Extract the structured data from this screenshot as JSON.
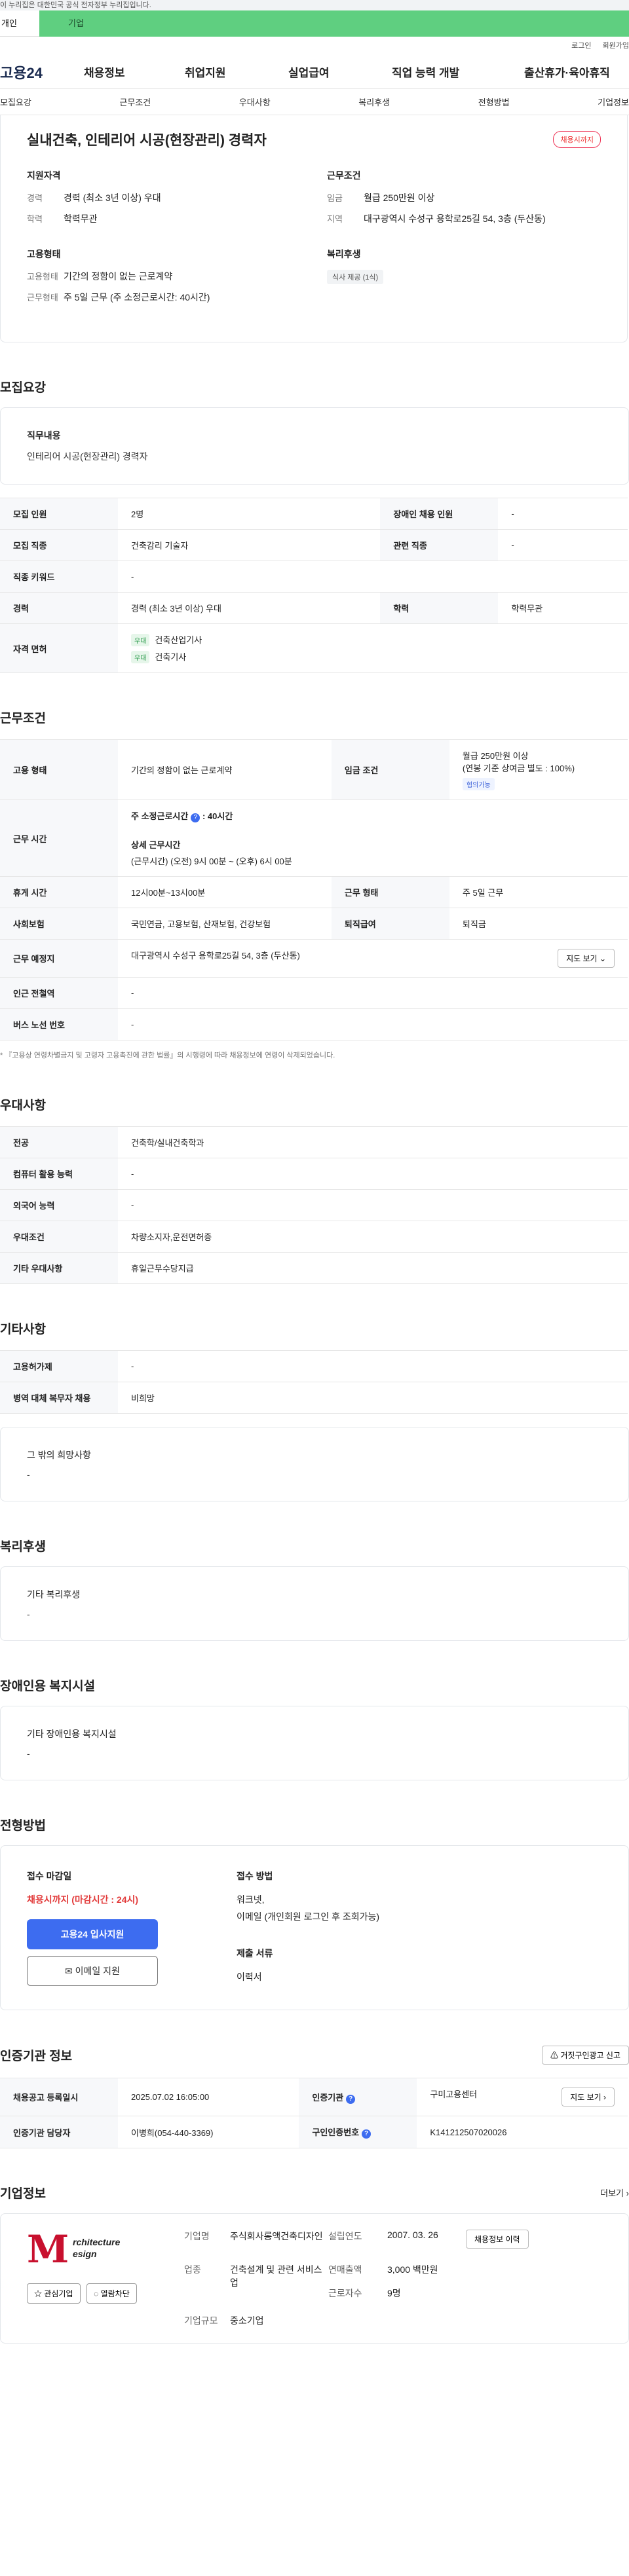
{
  "banner": "이 누리집은 대한민국 공식 전자정부 누리집입니다.",
  "top_tabs": {
    "person": "개인",
    "company": "기업"
  },
  "utility": {
    "login": "로그인",
    "join": "회원가입"
  },
  "gnb": {
    "logo": "고용24",
    "items": [
      "채용정보",
      "취업지원",
      "실업급여",
      "직업 능력 개발",
      "출산휴가·육아휴직"
    ]
  },
  "subnav": [
    "모집요강",
    "근무조건",
    "우대사항",
    "복리후생",
    "전형방법",
    "기업정보"
  ],
  "summary": {
    "title": "실내건축, 인테리어 시공(현장관리) 경력자",
    "deadline": "채용시까지",
    "qual": {
      "heading": "지원자격",
      "career_k": "경력",
      "career_v": "경력 (최소 3년 이상) 우대",
      "edu_k": "학력",
      "edu_v": "학력무관"
    },
    "cond": {
      "heading": "근무조건",
      "wage_k": "임금",
      "wage_v": "월급 250만원 이상",
      "loc_k": "지역",
      "loc_v": "대구광역시 수성구 용학로25길 54, 3층 (두산동)"
    },
    "emp": {
      "heading": "고용형태",
      "type_k": "고용형태",
      "type_v": "기간의 정함이 없는 근로계약",
      "form_k": "근무형태",
      "form_v": "주 5일 근무 (주 소정근로시간: 40시간)"
    },
    "welfare": {
      "heading": "복리후생",
      "chip": "식사 제공 (1식)"
    }
  },
  "recruit": {
    "title": "모집요강",
    "duty_h": "직무내용",
    "duty_v": "인테리어 시공(현장관리) 경력자",
    "headcount_k": "모집 인원",
    "headcount_v": "2명",
    "disabled_k": "장애인 채용 인원",
    "disabled_v": "-",
    "job_k": "모집 직종",
    "job_v": "건축감리 기술자",
    "rel_k": "관련 직종",
    "rel_v": "-",
    "kw_k": "직종 키워드",
    "kw_v": "-",
    "career_k": "경력",
    "career_v": "경력 (최소 3년 이상) 우대",
    "edu_k": "학력",
    "edu_v": "학력무관",
    "lic_k": "자격 면허",
    "lic_badge": "우대",
    "lic_1": "건축산업기사",
    "lic_2": "건축기사"
  },
  "work": {
    "title": "근무조건",
    "emp_k": "고용 형태",
    "emp_v": "기간의 정함이 없는 근로계약",
    "wage_k": "임금 조건",
    "wage_1": "월급 250만원 이상",
    "wage_2": "(연봉 기준 상여금 별도 : 100%)",
    "wage_chip": "협의가능",
    "hours_k": "근무 시간",
    "hours_1": "주 소정근로시간",
    "hours_1v": ": 40시간",
    "hours_2": "상세 근무시간",
    "hours_3": "(근무시간) (오전) 9시 00분 ~ (오후) 6시 00분",
    "rest_k": "휴게 시간",
    "rest_v": "12시00분~13시00분",
    "form_k": "근무 형태",
    "form_v": "주 5일 근무",
    "ins_k": "사회보험",
    "ins_v": "국민연금, 고용보험, 산재보험, 건강보험",
    "sev_k": "퇴직급여",
    "sev_v": "퇴직금",
    "loc_k": "근무 예정지",
    "loc_v": "대구광역시 수성구 용학로25길 54, 3층 (두산동)",
    "map_btn": "지도 보기",
    "ind_k": "인근 전철역",
    "ind_v": "-",
    "bus_k": "버스 노선 번호",
    "bus_v": "-",
    "note": "* 『고용상 연령차별금지 및 고령자 고용촉진에 관한 법률』의 시행령에 따라 채용정보에 연령이 삭제되었습니다."
  },
  "pref": {
    "title": "우대사항",
    "major_k": "전공",
    "major_v": "건축학/실내건축학과",
    "pc_k": "컴퓨터 활용 능력",
    "pc_v": "-",
    "lang_k": "외국어 능력",
    "lang_v": "-",
    "cond_k": "우대조건",
    "cond_v": "차량소지자,운전면허증",
    "etc_k": "기타 우대사항",
    "etc_v": "휴일근무수당지급"
  },
  "etc": {
    "title": "기타사항",
    "emp_k": "고용허가제",
    "emp_v": "-",
    "mil_k": "병역 대체 복무자 채용",
    "mil_v": "비희망",
    "req_h": "그 밖의 희망사항",
    "req_v": "-"
  },
  "welfare": {
    "title": "복리후생",
    "h": "기타 복리후생",
    "v": "-"
  },
  "disabled_fac": {
    "title": "장애인용 복지시설",
    "h": "기타 장애인용 복지시설",
    "v": "-"
  },
  "process": {
    "title": "전형방법",
    "deadline_h": "접수 마감일",
    "deadline_v": "채용시까지 (마감시간 : 24시)",
    "apply_btn": "고용24 입사지원",
    "email_btn": "이메일 지원",
    "method_h": "접수 방법",
    "method_1": "워크넷,",
    "method_2": "이메일 (개인회원 로그인 후 조회가능)",
    "docs_h": "제출 서류",
    "docs_v": "이력서"
  },
  "cert": {
    "title": "인증기관 정보",
    "report_btn": "거짓구인광고 신고",
    "reg_k": "채용공고 등록일시",
    "reg_v": "2025.07.02 16:05:00",
    "agency_k": "인증기관",
    "agency_v": "구미고용센터",
    "map_btn": "지도 보기",
    "mgr_k": "인증기관 담당자",
    "mgr_v": "이병희(054-440-3369)",
    "no_k": "구인인증번호",
    "no_v": "K141212507020026"
  },
  "company": {
    "title": "기업정보",
    "more": "더보기",
    "logo_text_1": "rchitecture",
    "logo_text_2": "esign",
    "fav_btn": "관심기업",
    "block_btn": "열람차단",
    "name_k": "기업명",
    "name_v": "주식회사롱액건축디자인",
    "found_k": "설립연도",
    "found_v": "2007. 03. 26",
    "hist_btn": "채용정보 이력",
    "ind_k": "업종",
    "ind_v": "건축설계 및 관련 서비스업",
    "sales_k": "연매출액",
    "sales_v": "3,000 백만원",
    "emp_k": "근로자수",
    "emp_v": "9명",
    "size_k": "기업규모",
    "size_v": "중소기업"
  }
}
